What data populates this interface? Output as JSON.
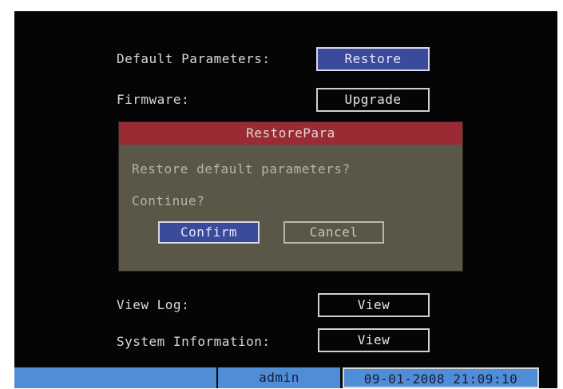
{
  "menu": {
    "default_params_label": "Default Parameters:",
    "restore_button": "Restore",
    "firmware_label": "Firmware:",
    "upgrade_button": "Upgrade",
    "view_log_label": "View Log:",
    "view_log_button": "View",
    "system_info_label": "System Information:",
    "system_info_button": "View"
  },
  "dialog": {
    "title": "RestorePara",
    "message": "Restore default parameters?",
    "question": "Continue?",
    "confirm_button": "Confirm",
    "cancel_button": "Cancel"
  },
  "status_bar": {
    "left": "",
    "user": "admin",
    "datetime": "09-01-2008 21:09:10"
  },
  "colors": {
    "screen_bg": "#050505",
    "focus_button": "#3b4a9a",
    "dialog_title_bar": "#9a2a34",
    "dialog_body": "#5a5648",
    "status_bar": "#4f8ed6"
  }
}
